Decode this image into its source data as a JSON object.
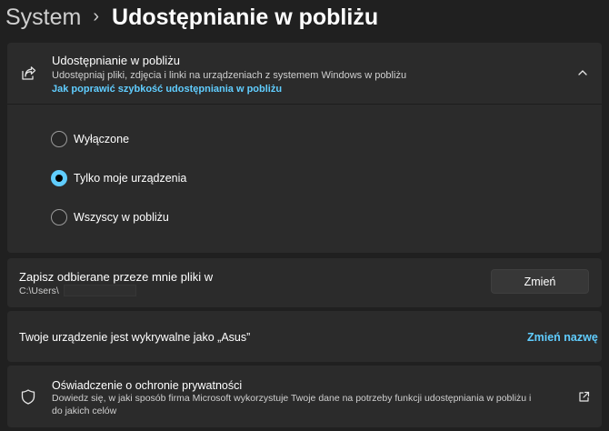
{
  "breadcrumb": {
    "parent": "System",
    "separator": "›",
    "current": "Udostępnianie w pobliżu"
  },
  "nearby_sharing": {
    "icon": "share-icon",
    "title": "Udostępnianie w pobliżu",
    "description": "Udostępniaj pliki, zdjęcia i linki na urządzeniach z systemem Windows w pobliżu",
    "help_link": "Jak poprawić szybkość udostępniania w pobliżu",
    "expanded": true,
    "options": [
      {
        "label": "Wyłączone",
        "selected": false
      },
      {
        "label": "Tylko moje urządzenia",
        "selected": true
      },
      {
        "label": "Wszyscy w pobliżu",
        "selected": false
      }
    ]
  },
  "save_location": {
    "title": "Zapisz odbierane przeze mnie pliki w",
    "path": "C:\\Users\\",
    "button_label": "Zmień"
  },
  "device": {
    "text": "Twoje urządzenie jest wykrywalne jako „Asus”",
    "rename_label": "Zmień nazwę"
  },
  "privacy": {
    "icon": "shield-icon",
    "title": "Oświadczenie o ochronie prywatności",
    "description": "Dowiedz się, w jaki sposób firma Microsoft wykorzystuje Twoje dane na potrzeby funkcji udostępniania w pobliżu i do jakich celów"
  },
  "colors": {
    "background": "#202020",
    "card": "#2b2b2b",
    "accent": "#60cdff"
  }
}
